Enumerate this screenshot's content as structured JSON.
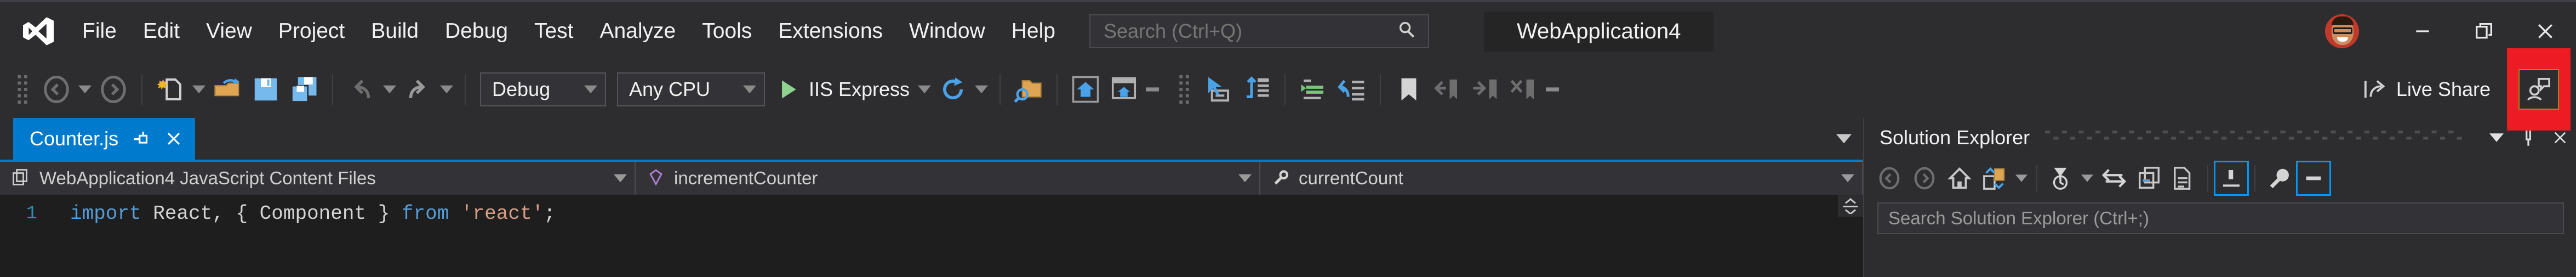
{
  "app": {
    "title": "WebApplication4",
    "logo_icon": "visual-studio-logo-icon"
  },
  "menubar": {
    "items": [
      {
        "label": "File"
      },
      {
        "label": "Edit"
      },
      {
        "label": "View"
      },
      {
        "label": "Project"
      },
      {
        "label": "Build"
      },
      {
        "label": "Debug"
      },
      {
        "label": "Test"
      },
      {
        "label": "Analyze"
      },
      {
        "label": "Tools"
      },
      {
        "label": "Extensions"
      },
      {
        "label": "Window"
      },
      {
        "label": "Help"
      }
    ]
  },
  "search": {
    "placeholder": "Search (Ctrl+Q)",
    "value": "",
    "icon": "search-icon"
  },
  "window_controls": {
    "minimize": "minimize-icon",
    "restore": "restore-icon",
    "close": "close-icon",
    "avatar": "user-avatar"
  },
  "toolbar": {
    "grip": "toolbar-grip",
    "navigate_back": "navigate-back-icon",
    "navigate_forward": "navigate-forward-icon",
    "new_file": "new-file-icon",
    "open_file": "open-file-icon",
    "save": "save-icon",
    "save_all": "save-all-icon",
    "undo": "undo-icon",
    "redo": "redo-icon",
    "configuration": {
      "value": "Debug"
    },
    "platform": {
      "value": "Any CPU"
    },
    "run_target": {
      "label": "IIS Express",
      "icon": "play-icon"
    },
    "refresh": "refresh-icon",
    "find_in_files": "find-in-files-icon",
    "home": "home-icon",
    "browser_preview": "browser-preview-icon",
    "select_element": "select-element-icon",
    "window_layout": "window-layout-icon",
    "comment_lines": "comment-lines-icon",
    "uncomment_lines": "uncomment-lines-icon",
    "toggle_bookmark": "bookmark-icon",
    "previous_bookmark": "previous-bookmark-icon",
    "next_bookmark": "next-bookmark-icon",
    "clear_bookmarks": "clear-bookmarks-icon",
    "live_share": {
      "label": "Live Share",
      "icon": "live-share-icon"
    },
    "feedback": {
      "icon": "send-feedback-icon",
      "highlight_color": "#ed1c24",
      "border_color": "#9a8a28"
    }
  },
  "editor": {
    "tabs": [
      {
        "label": "Counter.js",
        "active": true,
        "pin_icon": "pin-icon",
        "close_icon": "close-icon"
      }
    ],
    "tab_overflow_icon": "chevron-down-icon",
    "navbar": [
      {
        "label": "WebApplication4 JavaScript Content Files",
        "icon": "project-files-icon"
      },
      {
        "label": "incrementCounter",
        "icon": "method-icon"
      },
      {
        "label": "currentCount",
        "icon": "property-icon"
      }
    ],
    "lines": [
      {
        "number": "1",
        "tokens": [
          {
            "text": "import",
            "type": "kw"
          },
          {
            "text": " React, { Component } ",
            "type": "pl"
          },
          {
            "text": "from",
            "type": "kw"
          },
          {
            "text": " ",
            "type": "pl"
          },
          {
            "text": "'react'",
            "type": "str"
          },
          {
            "text": ";",
            "type": "pl"
          }
        ]
      }
    ],
    "split_handle_icon": "split-view-icon"
  },
  "solution_explorer": {
    "title": "Solution Explorer",
    "header_buttons": [
      {
        "icon": "chevron-down-icon"
      },
      {
        "icon": "pin-icon"
      },
      {
        "icon": "close-icon"
      }
    ],
    "toolbar": [
      {
        "icon": "navigate-back-icon"
      },
      {
        "icon": "navigate-forward-icon"
      },
      {
        "icon": "home-icon"
      },
      {
        "icon": "sync-with-active-document-icon"
      },
      {
        "icon": "chevron-down-icon"
      },
      {
        "icon": "pending-changes-filter-icon"
      },
      {
        "icon": "chevron-down-icon"
      },
      {
        "icon": "switch-views-icon"
      },
      {
        "icon": "collapse-all-icon"
      },
      {
        "icon": "show-all-files-icon"
      },
      {
        "icon": "preview-selected-items-icon"
      },
      {
        "icon": "properties-icon"
      }
    ],
    "search": {
      "placeholder": "Search Solution Explorer (Ctrl+;)",
      "value": ""
    }
  },
  "colors": {
    "accent": "#007acc",
    "chrome": "#2d2d30",
    "editor_bg": "#1e1e1e",
    "highlight_red": "#ed1c24",
    "keyword": "#569cd6",
    "string": "#d69d85",
    "line_number": "#2b91af"
  }
}
